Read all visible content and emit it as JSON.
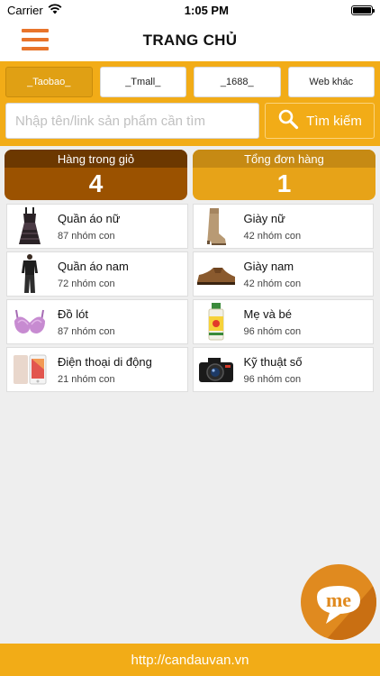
{
  "status_bar": {
    "carrier": "Carrier",
    "time": "1:05 PM",
    "icons": [
      "wifi-icon",
      "battery-icon"
    ]
  },
  "header": {
    "menu_icon": "hamburger-menu-icon",
    "title": "TRANG CHỦ",
    "accent_color": "#e8742b"
  },
  "source_tabs": [
    {
      "label": "_Taobao_",
      "active": true
    },
    {
      "label": "_Tmall_",
      "active": false
    },
    {
      "label": "_1688_",
      "active": false
    },
    {
      "label": "Web khác",
      "active": false
    }
  ],
  "search": {
    "placeholder": "Nhập tên/link sản phẩm cần tìm",
    "value": "",
    "button_label": "Tìm kiếm",
    "button_icon": "search-icon"
  },
  "stats": {
    "cart": {
      "label": "Hàng trong giỏ",
      "value": "4"
    },
    "orders": {
      "label": "Tổng đơn hàng",
      "value": "1"
    }
  },
  "categories": [
    {
      "name": "Quần áo nữ",
      "count": "87 nhóm con",
      "icon": "dress-image"
    },
    {
      "name": "Giày nữ",
      "count": "42 nhóm con",
      "icon": "womens-boot-image"
    },
    {
      "name": "Quần áo nam",
      "count": "72 nhóm con",
      "icon": "mens-outfit-image"
    },
    {
      "name": "Giày nam",
      "count": "42 nhóm con",
      "icon": "mens-shoe-image"
    },
    {
      "name": "Đồ lót",
      "count": "87 nhóm con",
      "icon": "bra-image"
    },
    {
      "name": "Mẹ và bé",
      "count": "96 nhóm con",
      "icon": "baby-bottle-image"
    },
    {
      "name": "Điện thoại di động",
      "count": "21 nhóm con",
      "icon": "smartphone-image"
    },
    {
      "name": "Kỹ thuật số",
      "count": "96 nhóm con",
      "icon": "camera-image"
    }
  ],
  "chat": {
    "label": "me",
    "icon": "chat-bubble-icon"
  },
  "footer": {
    "url": "http://candauvan.vn"
  },
  "colors": {
    "brand_orange": "#f2ac17",
    "cart_brown": "#9b5200",
    "orders_gold": "#e7a318"
  }
}
